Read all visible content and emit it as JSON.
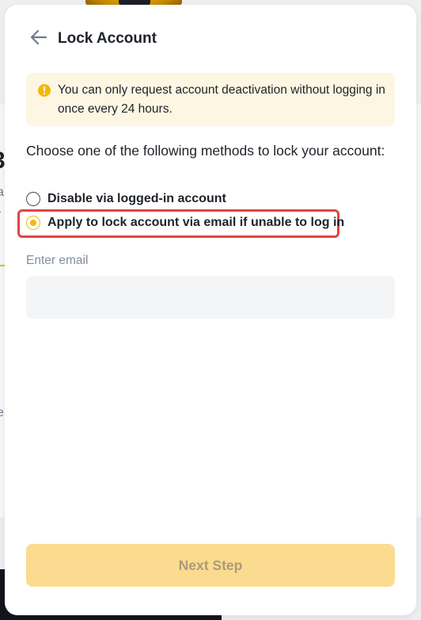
{
  "modal": {
    "title": "Lock Account",
    "notice": "You can only request account deactivation without logging in once every 24 hours.",
    "instruction": "Choose one of the following methods to lock your account:",
    "options": [
      {
        "label": "Disable via logged-in account",
        "selected": false
      },
      {
        "label": "Apply to lock account via email if unable to log in",
        "selected": true
      }
    ],
    "email": {
      "label": "Enter email",
      "value": "",
      "placeholder": ""
    },
    "next_button_label": "Next Step"
  },
  "background": {
    "fragments": [
      "3",
      "a",
      "r",
      "e"
    ]
  },
  "colors": {
    "accent": "#F0B90B",
    "notice_bg": "#FDF6E3",
    "highlight": "#E04646",
    "disabled_button": "#FBDB90"
  },
  "icons": {
    "back": "arrow-left-icon",
    "notice": "alert-circle-icon"
  }
}
